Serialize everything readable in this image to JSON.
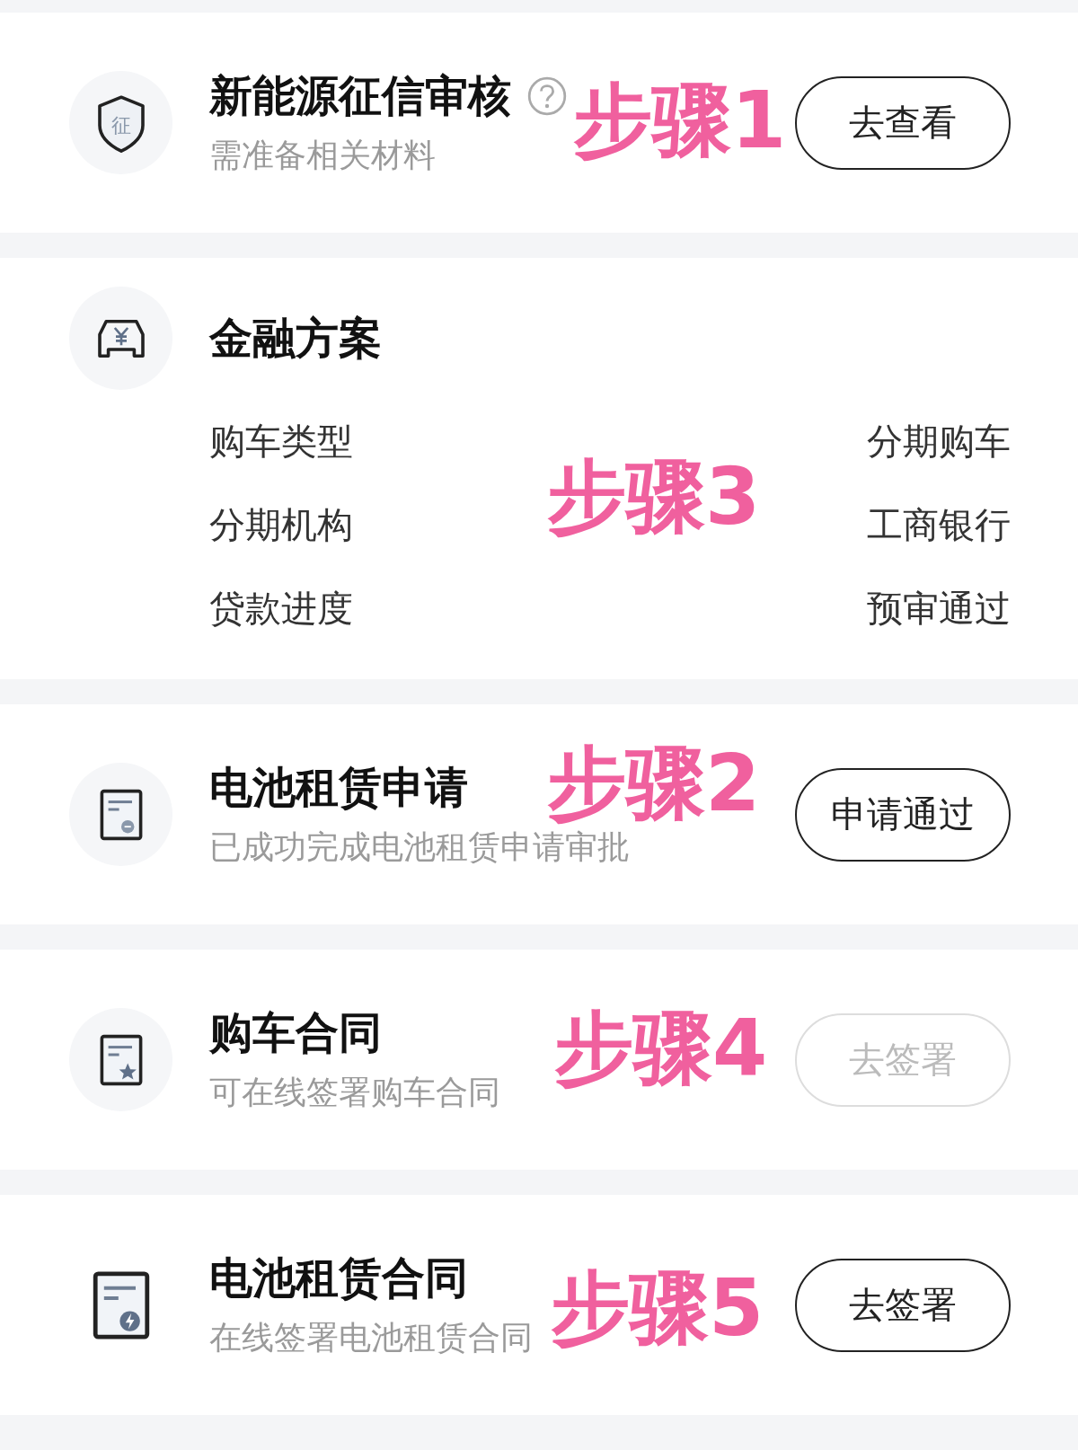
{
  "cards": [
    {
      "kind": "task",
      "icon_text": "征",
      "title": "新能源征信审核",
      "help": true,
      "subtitle": "需准备相关材料",
      "button": {
        "label": "去查看",
        "disabled": false
      },
      "annotation": "步骤1"
    },
    {
      "kind": "details",
      "title": "金融方案",
      "rows": [
        {
          "label": "购车类型",
          "value": "分期购车"
        },
        {
          "label": "分期机构",
          "value": "工商银行"
        },
        {
          "label": "贷款进度",
          "value": "预审通过"
        }
      ],
      "annotation": "步骤3"
    },
    {
      "kind": "task",
      "title": "电池租赁申请",
      "help": false,
      "subtitle": "已成功完成电池租赁申请审批",
      "button": {
        "label": "申请通过",
        "disabled": false
      },
      "annotation": "步骤2"
    },
    {
      "kind": "task",
      "title": "购车合同",
      "help": false,
      "subtitle": "可在线签署购车合同",
      "button": {
        "label": "去签署",
        "disabled": true
      },
      "annotation": "步骤4"
    },
    {
      "kind": "task",
      "title": "电池租赁合同",
      "help": false,
      "subtitle": "在线签署电池租赁合同",
      "button": {
        "label": "去签署",
        "disabled": false
      },
      "annotation": "步骤5"
    }
  ]
}
